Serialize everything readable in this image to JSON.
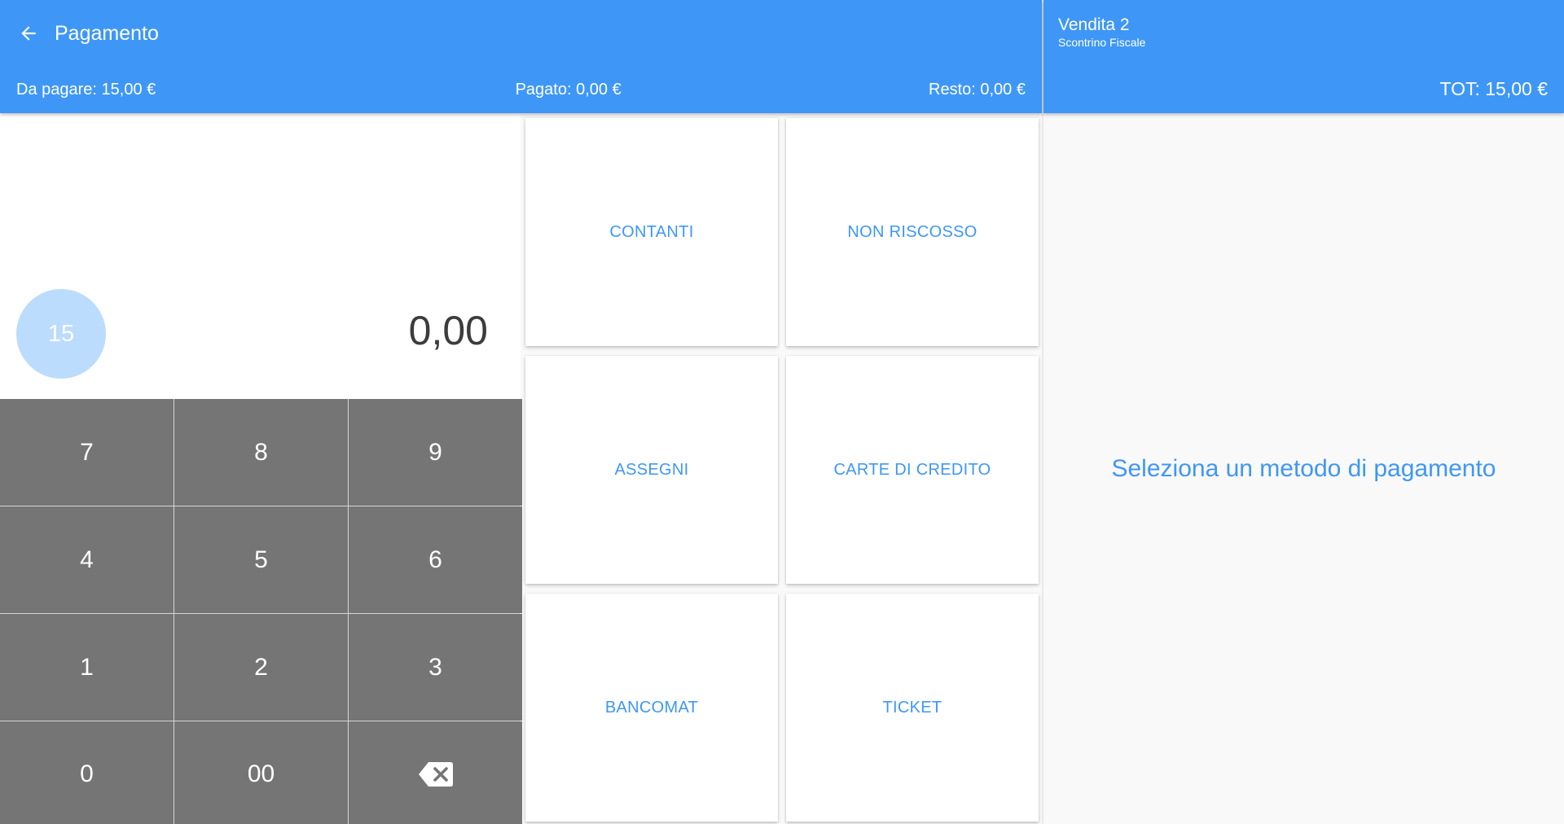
{
  "header": {
    "title": "Pagamento",
    "to_pay": "Da pagare: 15,00 €",
    "paid": "Pagato: 0,00 €",
    "change": "Resto: 0,00 €"
  },
  "sale": {
    "title": "Vendita 2",
    "subtitle": "Scontrino Fiscale",
    "total": "TOT: 15,00 €"
  },
  "display": {
    "quick_amount": "15",
    "amount": "0,00"
  },
  "keypad": {
    "keys": [
      "7",
      "8",
      "9",
      "4",
      "5",
      "6",
      "1",
      "2",
      "3",
      "0",
      "00"
    ]
  },
  "methods": [
    "CONTANTI",
    "NON RISCOSSO",
    "ASSEGNI",
    "CARTE DI CREDITO",
    "BANCOMAT",
    "TICKET"
  ],
  "panel": {
    "hint": "Seleziona un metodo di pagamento"
  },
  "colors": {
    "primary": "#3e97f6",
    "keypad": "#757575",
    "chip": "#bcdcfe"
  }
}
